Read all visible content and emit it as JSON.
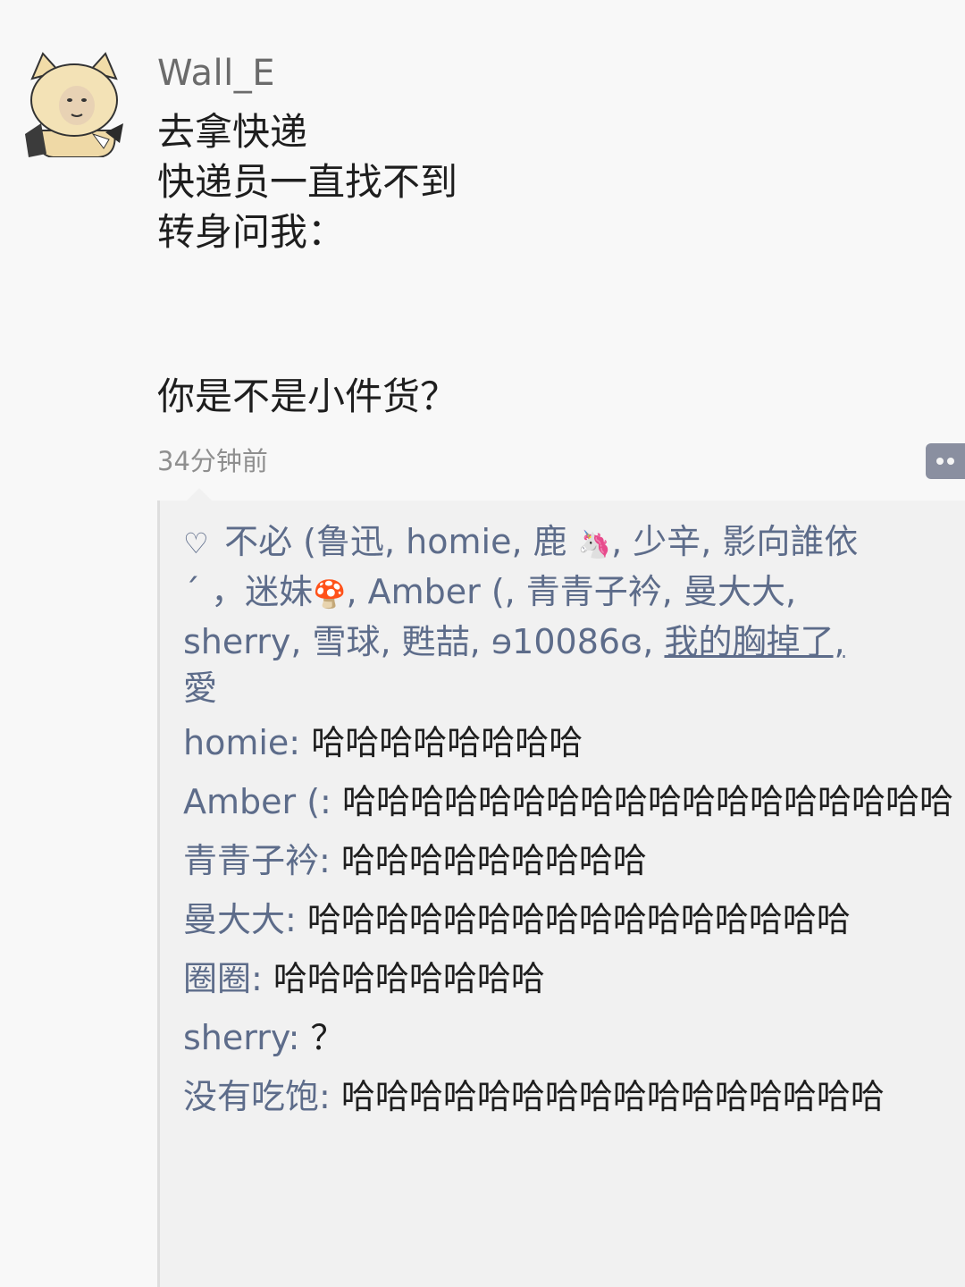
{
  "post": {
    "username": "Wall_E",
    "lines": [
      "去拿快递",
      "快递员一直找不到",
      "转身问我："
    ],
    "punchline": "你是不是小件货？",
    "timestamp": "34分钟前"
  },
  "likes": {
    "icon": "heart-outline-icon",
    "prefix": "不必 (",
    "text": "鲁迅, homie, 鹿",
    "emoji_1": "unicorn-emoji",
    "text_2": ", 少辛, 影向誰依",
    "text_3": "ˊ ，迷妹",
    "emoji_2": "mushroom-emoji",
    "text_4": ", Amber (, 青青子衿, 曼大大,",
    "text_5": "sherry, 雪球, 甦喆, ɘ10086ɞ,",
    "last_liker": "我的胸掉了,",
    "text_6": "愛"
  },
  "comments": [
    {
      "name": "homie",
      "sep": ": ",
      "text": "哈哈哈哈哈哈哈哈"
    },
    {
      "name": "Amber (",
      "sep": ": ",
      "text": "哈哈哈哈哈哈哈哈哈哈哈哈哈哈哈哈哈哈"
    },
    {
      "name": "青青子衿",
      "sep": ": ",
      "text": "哈哈哈哈哈哈哈哈哈"
    },
    {
      "name": "曼大大",
      "sep": ": ",
      "text": "哈哈哈哈哈哈哈哈哈哈哈哈哈哈哈哈"
    },
    {
      "name": "圈圈",
      "sep": ": ",
      "text": "哈哈哈哈哈哈哈哈"
    },
    {
      "name": "sherry",
      "sep": ": ",
      "text": "？"
    },
    {
      "name": "没有吃饱",
      "sep": ": ",
      "text": "哈哈哈哈哈哈哈哈哈哈哈哈哈哈哈哈"
    }
  ],
  "colors": {
    "link": "#5d6c8a",
    "text": "#1e1e1e",
    "meta": "#8f8f8f"
  }
}
